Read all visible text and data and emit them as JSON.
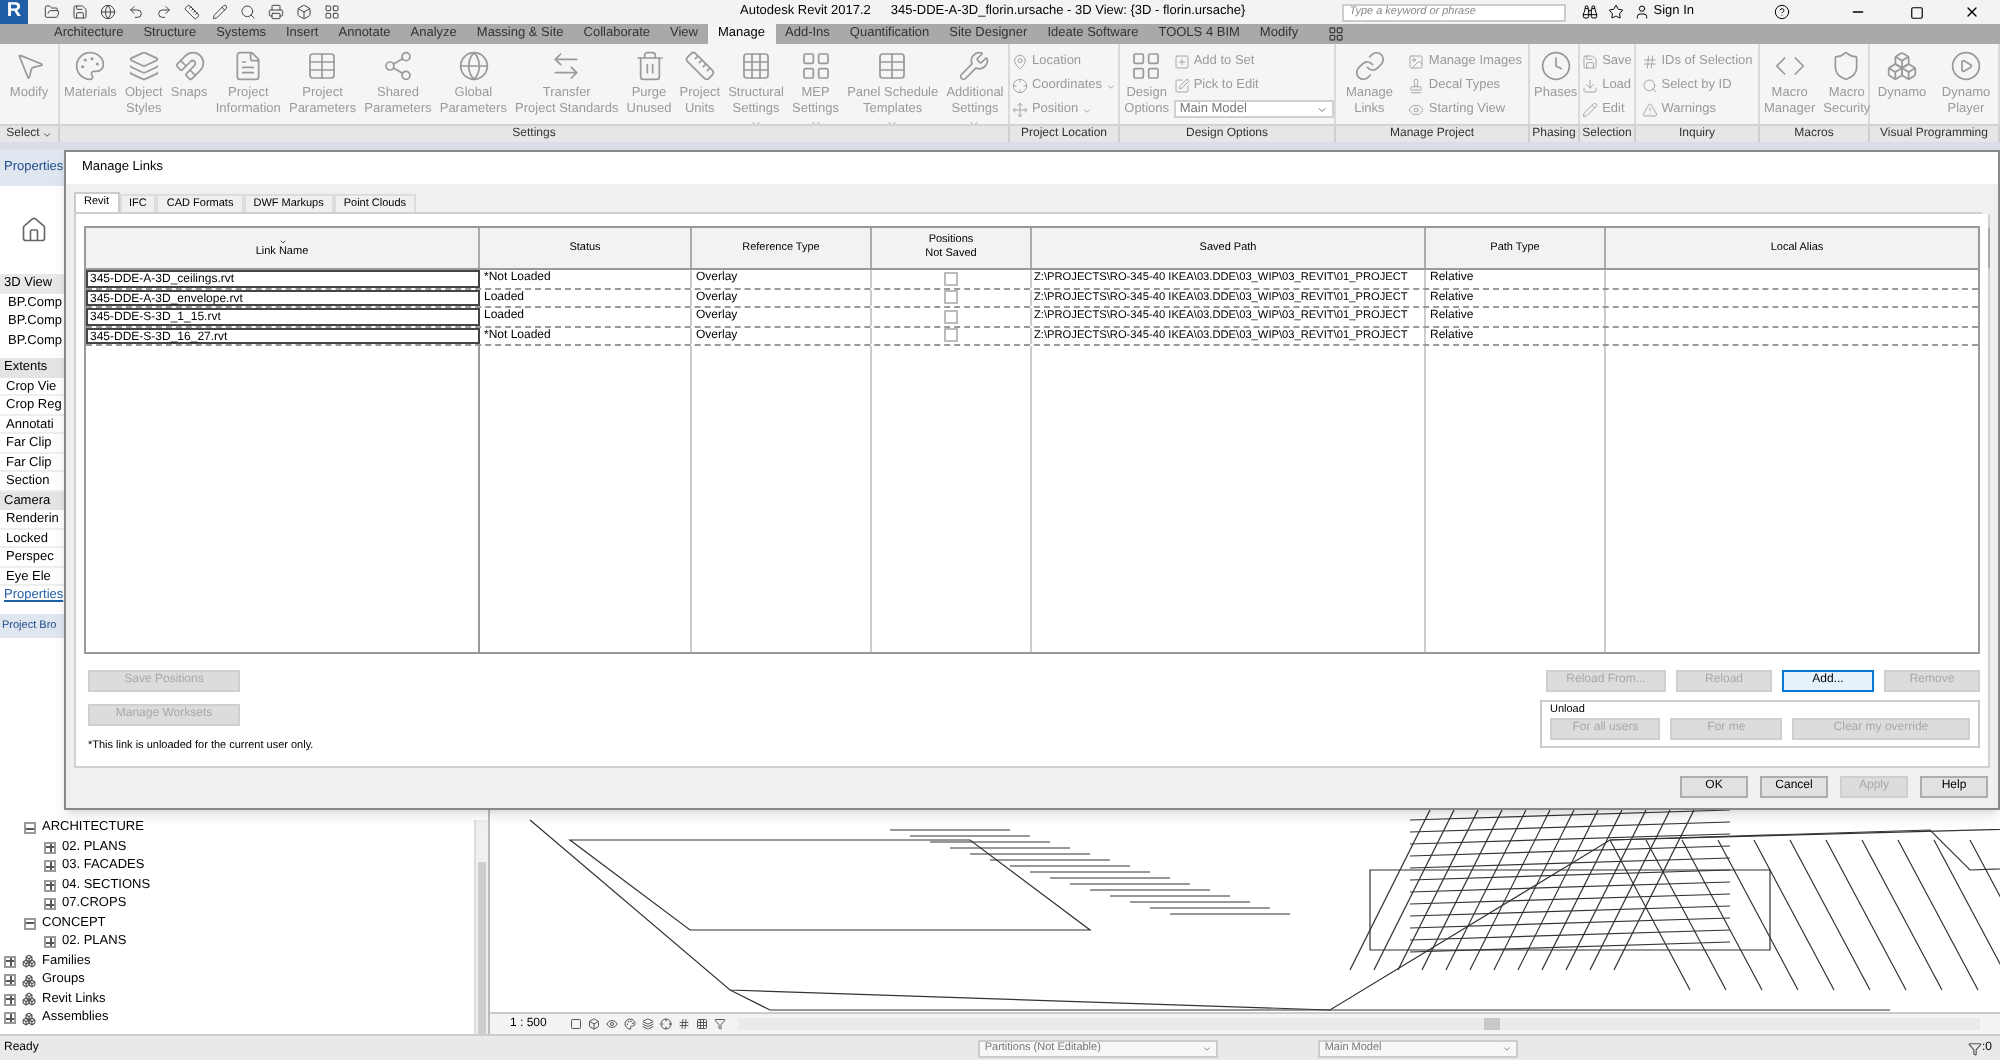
{
  "title_bar": {
    "app_logo": "R",
    "app_title": "Autodesk Revit 2017.2",
    "document_title": "345-DDE-A-3D_florin.ursache - 3D View: {3D - florin.ursache}",
    "search": {
      "placeholder": "Type a keyword or phrase"
    },
    "sign_in": "Sign In"
  },
  "ribbon": {
    "tabs": [
      {
        "label": "Architecture",
        "selected": false
      },
      {
        "label": "Structure",
        "selected": false
      },
      {
        "label": "Systems",
        "selected": false
      },
      {
        "label": "Insert",
        "selected": false
      },
      {
        "label": "Annotate",
        "selected": false
      },
      {
        "label": "Analyze",
        "selected": false
      },
      {
        "label": "Massing & Site",
        "selected": false
      },
      {
        "label": "Collaborate",
        "selected": false
      },
      {
        "label": "View",
        "selected": false
      },
      {
        "label": "Manage",
        "selected": true
      },
      {
        "label": "Add-Ins",
        "selected": false
      },
      {
        "label": "Quantification",
        "selected": false
      },
      {
        "label": "Site Designer",
        "selected": false
      },
      {
        "label": "Ideate Software",
        "selected": false
      },
      {
        "label": "TOOLS 4 BIM",
        "selected": false
      },
      {
        "label": "Modify",
        "selected": false
      }
    ],
    "panels": [
      {
        "label": "Select",
        "dropdown": true,
        "buttons": [
          {
            "kind": "large",
            "label": "Modify"
          }
        ]
      },
      {
        "label": "Settings",
        "dropdown": false,
        "buttons": [
          {
            "kind": "large",
            "label": "Materials"
          },
          {
            "kind": "large",
            "label": "Object\nStyles"
          },
          {
            "kind": "large",
            "label": "Snaps"
          },
          {
            "kind": "large",
            "label": "Project\nInformation"
          },
          {
            "kind": "large",
            "label": "Project\nParameters"
          },
          {
            "kind": "large",
            "label": "Shared\nParameters"
          },
          {
            "kind": "large",
            "label": "Global\nParameters"
          },
          {
            "kind": "large",
            "label": "Transfer\nProject Standards"
          },
          {
            "kind": "large",
            "label": "Purge\nUnused"
          },
          {
            "kind": "large",
            "label": "Project\nUnits"
          },
          {
            "kind": "large",
            "label": "Structural\nSettings",
            "dropdown": true
          },
          {
            "kind": "large",
            "label": "MEP\nSettings",
            "dropdown": true
          },
          {
            "kind": "large",
            "label": "Panel Schedule\nTemplates",
            "dropdown": true
          },
          {
            "kind": "large",
            "label": "Additional\nSettings",
            "dropdown": true
          }
        ]
      },
      {
        "label": "Project Location",
        "dropdown": false,
        "buttons": [
          {
            "kind": "small",
            "label": "Location"
          },
          {
            "kind": "small",
            "label": "Coordinates",
            "dropdown": true
          },
          {
            "kind": "small",
            "label": "Position",
            "dropdown": true
          }
        ]
      },
      {
        "label": "Design Options",
        "dropdown": false,
        "buttons": [
          {
            "kind": "large",
            "label": "Design\nOptions"
          },
          {
            "kind": "small",
            "label": "Add to Set"
          },
          {
            "kind": "small",
            "label": "Pick to Edit"
          },
          {
            "kind": "select",
            "label": "Main Model"
          }
        ]
      },
      {
        "label": "Manage Project",
        "dropdown": false,
        "buttons": [
          {
            "kind": "large",
            "label": "Manage\nLinks"
          },
          {
            "kind": "small",
            "label": "Manage Images"
          },
          {
            "kind": "small",
            "label": "Decal Types"
          },
          {
            "kind": "small",
            "label": "Starting View"
          }
        ]
      },
      {
        "label": "Phasing",
        "dropdown": false,
        "buttons": [
          {
            "kind": "large",
            "label": "Phases"
          }
        ]
      },
      {
        "label": "Selection",
        "dropdown": false,
        "buttons": [
          {
            "kind": "small",
            "label": "Save"
          },
          {
            "kind": "small",
            "label": "Load"
          },
          {
            "kind": "small",
            "label": "Edit"
          }
        ]
      },
      {
        "label": "Inquiry",
        "dropdown": false,
        "buttons": [
          {
            "kind": "small",
            "label": "IDs of Selection"
          },
          {
            "kind": "small",
            "label": "Select by ID"
          },
          {
            "kind": "small",
            "label": "Warnings"
          }
        ]
      },
      {
        "label": "Macros",
        "dropdown": false,
        "buttons": [
          {
            "kind": "large",
            "label": "Macro\nManager"
          },
          {
            "kind": "large",
            "label": "Macro\nSecurity"
          }
        ]
      },
      {
        "label": "Visual Programming",
        "dropdown": false,
        "buttons": [
          {
            "kind": "large",
            "label": "Dynamo"
          },
          {
            "kind": "large",
            "label": "Dynamo\nPlayer"
          }
        ]
      }
    ]
  },
  "properties": {
    "title": "Properties",
    "type_selector": "3D View",
    "instances": [
      "BP.Comp",
      "BP.Comp",
      "BP.Comp"
    ],
    "rows": [
      {
        "kind": "heading",
        "label": "Extents"
      },
      {
        "kind": "param",
        "label": "Crop Vie"
      },
      {
        "kind": "param",
        "label": "Crop Reg"
      },
      {
        "kind": "param",
        "label": "Annotati"
      },
      {
        "kind": "param",
        "label": "Far Clip"
      },
      {
        "kind": "param",
        "label": "Far Clip"
      },
      {
        "kind": "param",
        "label": "Section"
      },
      {
        "kind": "heading",
        "label": "Camera"
      },
      {
        "kind": "param",
        "label": "Renderin"
      },
      {
        "kind": "param",
        "label": "Locked"
      },
      {
        "kind": "param",
        "label": "Perspec"
      },
      {
        "kind": "param",
        "label": "Eye Ele"
      }
    ],
    "link": "Properties"
  },
  "project_browser": {
    "title": "Project Bro",
    "items": [
      {
        "kind": "group",
        "label": "ARCHITECTURE",
        "expanded": true,
        "children": [
          {
            "label": "02. PLANS",
            "expanded": false
          },
          {
            "label": "03. FACADES",
            "expanded": false
          },
          {
            "label": "04. SECTIONS",
            "expanded": false
          },
          {
            "label": "07.CROPS",
            "expanded": false
          }
        ]
      },
      {
        "kind": "group",
        "label": "CONCEPT",
        "expanded": true,
        "children": [
          {
            "label": "02. PLANS",
            "expanded": false
          }
        ]
      },
      {
        "kind": "category",
        "label": "Families",
        "expanded": false
      },
      {
        "kind": "category",
        "label": "Groups",
        "expanded": false
      },
      {
        "kind": "category",
        "label": "Revit Links",
        "expanded": false
      },
      {
        "kind": "category",
        "label": "Assemblies",
        "expanded": false
      }
    ]
  },
  "view": {
    "scale": "1 : 500"
  },
  "dialog": {
    "title": "Manage Links",
    "tabs": [
      {
        "label": "Revit",
        "selected": true
      },
      {
        "label": "IFC",
        "selected": false
      },
      {
        "label": "CAD Formats",
        "selected": false
      },
      {
        "label": "DWF Markups",
        "selected": false
      },
      {
        "label": "Point Clouds",
        "selected": false
      }
    ],
    "table": {
      "columns": [
        {
          "label": "Link Name",
          "sorted": true
        },
        {
          "label": "Status",
          "sorted": false
        },
        {
          "label": "Reference Type",
          "sorted": false
        },
        {
          "label": "Positions\nNot Saved",
          "sorted": false
        },
        {
          "label": "Saved Path",
          "sorted": false
        },
        {
          "label": "Path Type",
          "sorted": false
        },
        {
          "label": "Local Alias",
          "sorted": false
        }
      ],
      "rows": [
        {
          "link_name": "345-DDE-A-3D_ceilings.rvt",
          "status": "*Not Loaded",
          "reference_type": "Overlay",
          "positions_not_saved": false,
          "saved_path": "Z:\\PROJECTS\\RO-345-40 IKEA\\03.DDE\\03_WIP\\03_REVIT\\01_PROJECT",
          "path_type": "Relative"
        },
        {
          "link_name": "345-DDE-A-3D_envelope.rvt",
          "status": "Loaded",
          "reference_type": "Overlay",
          "positions_not_saved": false,
          "saved_path": "Z:\\PROJECTS\\RO-345-40 IKEA\\03.DDE\\03_WIP\\03_REVIT\\01_PROJECT",
          "path_type": "Relative"
        },
        {
          "link_name": "345-DDE-S-3D_1_15.rvt",
          "status": "Loaded",
          "reference_type": "Overlay",
          "positions_not_saved": false,
          "saved_path": "Z:\\PROJECTS\\RO-345-40 IKEA\\03.DDE\\03_WIP\\03_REVIT\\01_PROJECT",
          "path_type": "Relative"
        },
        {
          "link_name": "345-DDE-S-3D_16_27.rvt",
          "status": "*Not Loaded",
          "reference_type": "Overlay",
          "positions_not_saved": false,
          "saved_path": "Z:\\PROJECTS\\RO-345-40 IKEA\\03.DDE\\03_WIP\\03_REVIT\\01_PROJECT",
          "path_type": "Relative"
        }
      ]
    },
    "left_buttons": [
      {
        "label": "Save Positions",
        "disabled": true
      },
      {
        "label": "Manage Worksets",
        "disabled": true
      }
    ],
    "note": "*This link is unloaded for the current user only.",
    "link_buttons": [
      {
        "label": "Reload From...",
        "disabled": true
      },
      {
        "label": "Reload",
        "disabled": true
      },
      {
        "label": "Add...",
        "disabled": false
      },
      {
        "label": "Remove",
        "disabled": true
      }
    ],
    "unload": {
      "label": "Unload",
      "buttons": [
        {
          "label": "For all users",
          "disabled": true
        },
        {
          "label": "For me",
          "disabled": true
        },
        {
          "label": "Clear my override",
          "disabled": true
        }
      ]
    },
    "footer_buttons": [
      {
        "label": "OK",
        "disabled": false
      },
      {
        "label": "Cancel",
        "disabled": false
      },
      {
        "label": "Apply",
        "disabled": true
      },
      {
        "label": "Help",
        "disabled": false
      }
    ]
  },
  "status_bar": {
    "message": "Ready",
    "workset": "Partitions (Not Editable)",
    "design_option": "Main Model",
    "filter_count": ":0"
  }
}
